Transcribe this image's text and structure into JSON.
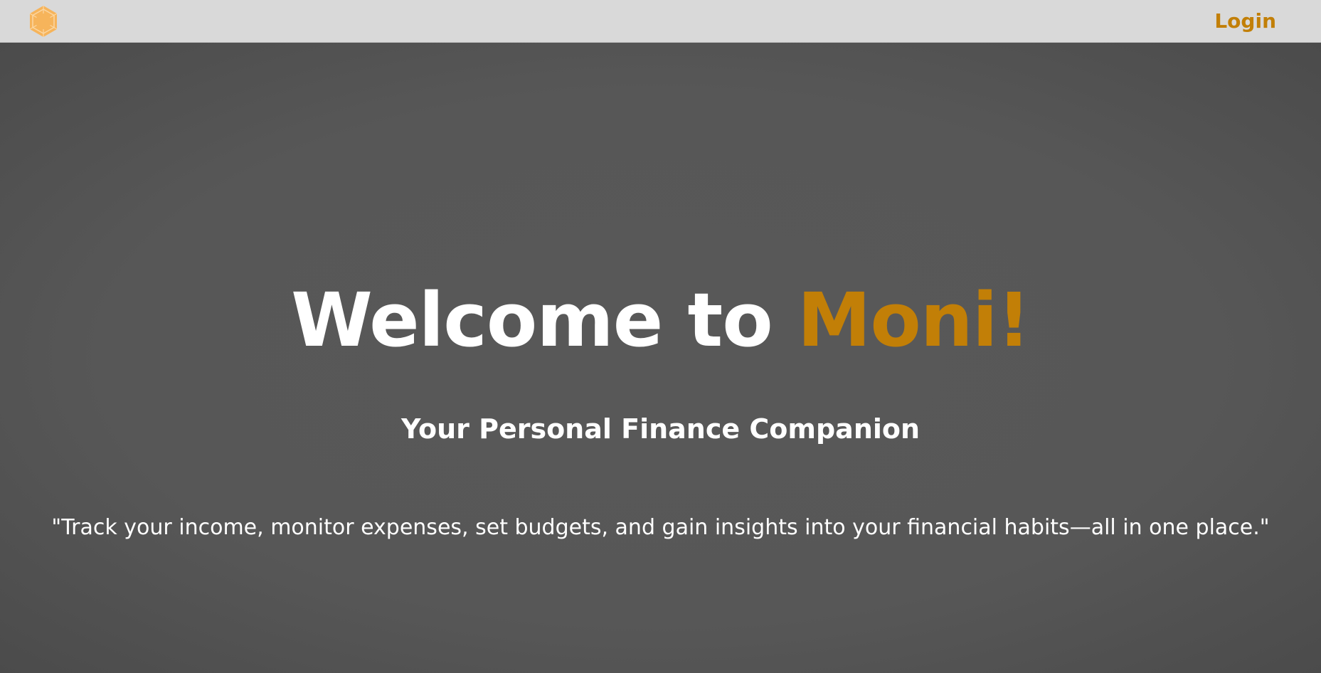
{
  "header": {
    "logo_icon": "hexagon-sun-icon",
    "login_label": "Login"
  },
  "hero": {
    "headline_prefix": "Welcome to ",
    "headline_brand": "Moni!",
    "subtitle": "Your Personal Finance Companion",
    "tagline": "\"Track your income, monitor expenses, set budgets, and gain insights into your financial habits—all in one place.\""
  },
  "colors": {
    "accent": "#c27f07",
    "logo": "#f6b45b",
    "header_bg": "#d9d9d9",
    "hero_bg": "#575757"
  }
}
